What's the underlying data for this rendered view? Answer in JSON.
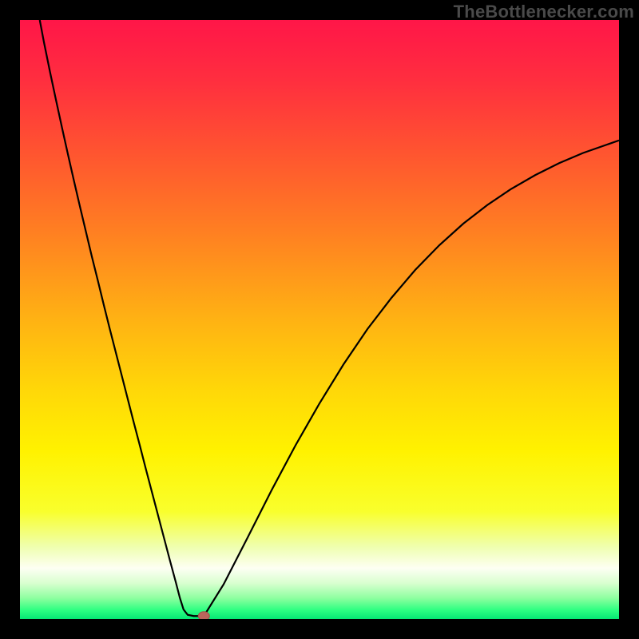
{
  "watermark": "TheBottlenecker.com",
  "colors": {
    "frame": "#000000",
    "curve": "#000000",
    "marker_fill": "#b9655c",
    "marker_stroke": "#a15048",
    "gradient_stops": [
      {
        "offset": 0.0,
        "color": "#ff1648"
      },
      {
        "offset": 0.1,
        "color": "#ff2e3f"
      },
      {
        "offset": 0.22,
        "color": "#ff5430"
      },
      {
        "offset": 0.35,
        "color": "#ff7e22"
      },
      {
        "offset": 0.5,
        "color": "#ffb213"
      },
      {
        "offset": 0.62,
        "color": "#ffd808"
      },
      {
        "offset": 0.72,
        "color": "#fff200"
      },
      {
        "offset": 0.82,
        "color": "#f9ff2c"
      },
      {
        "offset": 0.88,
        "color": "#efffb0"
      },
      {
        "offset": 0.915,
        "color": "#fdfff3"
      },
      {
        "offset": 0.94,
        "color": "#d9ffd0"
      },
      {
        "offset": 0.965,
        "color": "#8effa0"
      },
      {
        "offset": 0.985,
        "color": "#2dff82"
      },
      {
        "offset": 1.0,
        "color": "#05e874"
      }
    ]
  },
  "chart_data": {
    "type": "line",
    "title": "",
    "xlabel": "",
    "ylabel": "",
    "xlim": [
      0,
      100
    ],
    "ylim": [
      0,
      100
    ],
    "grid": false,
    "legend": false,
    "x": [
      3.3,
      4,
      5,
      6,
      7,
      8,
      9,
      10,
      11,
      12,
      13,
      14,
      15,
      16,
      17,
      18,
      19,
      20,
      21,
      22,
      23,
      24,
      25,
      26,
      26.7,
      27.3,
      28,
      29,
      30,
      30.7,
      30.7,
      34,
      38,
      42,
      46,
      50,
      54,
      58,
      62,
      66,
      70,
      74,
      78,
      82,
      86,
      90,
      94,
      98,
      100
    ],
    "values": [
      100.0,
      96.3,
      91.4,
      86.7,
      82.1,
      77.6,
      73.2,
      68.9,
      64.7,
      60.5,
      56.5,
      52.4,
      48.4,
      44.5,
      40.6,
      36.7,
      32.8,
      29.0,
      25.1,
      21.3,
      17.5,
      13.7,
      9.9,
      6.2,
      3.5,
      1.6,
      0.7,
      0.5,
      0.5,
      0.5,
      0.5,
      5.8,
      13.6,
      21.5,
      29.0,
      36.0,
      42.5,
      48.4,
      53.6,
      58.3,
      62.4,
      66.0,
      69.1,
      71.8,
      74.1,
      76.1,
      77.8,
      79.2,
      79.9
    ],
    "marker": {
      "x": 30.7,
      "y": 0.5
    }
  }
}
